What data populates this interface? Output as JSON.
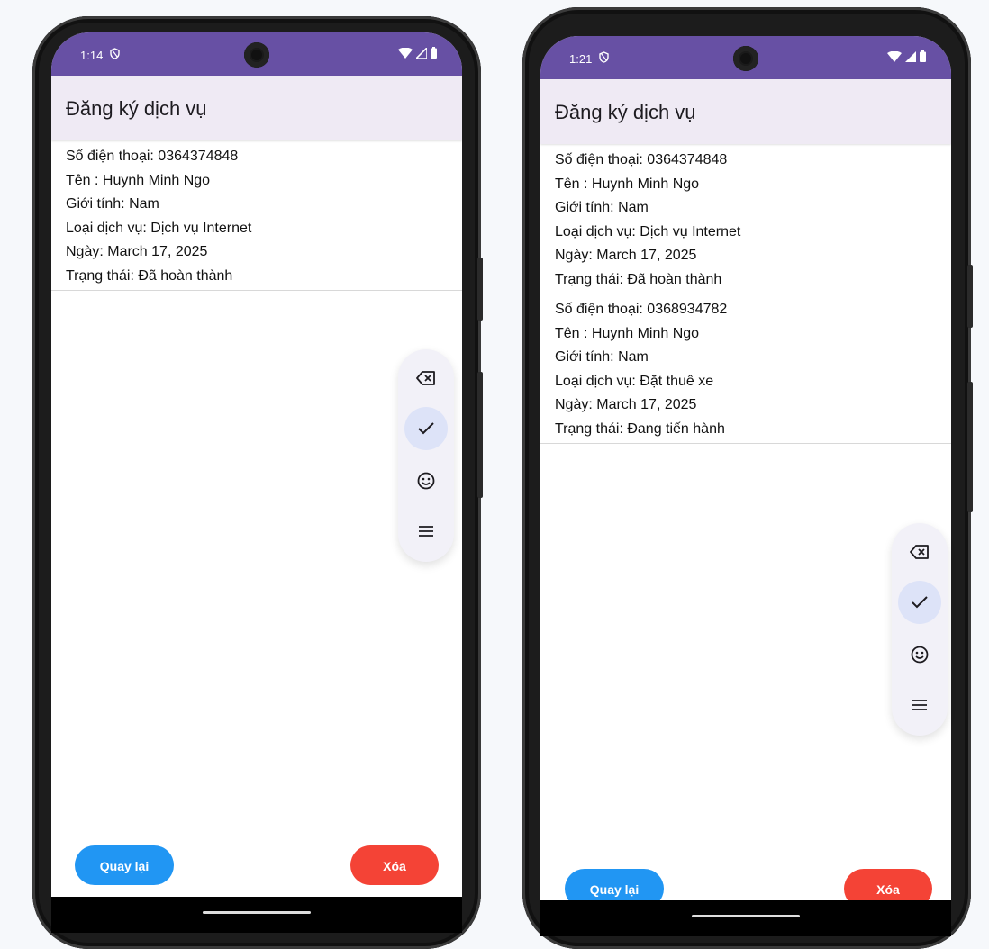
{
  "phones": [
    {
      "status_time": "1:14",
      "app_title": "Đăng ký dịch vụ",
      "records": [
        {
          "lines": [
            "Số điện thoại: 0364374848",
            "Tên : Huynh Minh Ngo",
            "Giới tính: Nam",
            "Loại dịch vụ: Dịch vụ Internet",
            "Ngày: March 17, 2025",
            "Trạng thái: Đã hoàn thành"
          ]
        }
      ],
      "back_label": "Quay lại",
      "delete_label": "Xóa"
    },
    {
      "status_time": "1:21",
      "app_title": "Đăng ký dịch vụ",
      "records": [
        {
          "lines": [
            "Số điện thoại: 0364374848",
            "Tên : Huynh Minh Ngo",
            "Giới tính: Nam",
            "Loại dịch vụ: Dịch vụ Internet",
            "Ngày: March 17, 2025",
            "Trạng thái: Đã hoàn thành"
          ]
        },
        {
          "lines": [
            "Số điện thoại: 0368934782",
            "Tên : Huynh Minh Ngo",
            "Giới tính: Nam",
            "Loại dịch vụ: Đặt thuê xe",
            "Ngày: March 17, 2025",
            "Trạng thái: Đang tiến hành"
          ]
        }
      ],
      "back_label": "Quay lại",
      "delete_label": "Xóa"
    }
  ],
  "floating_toolbar_icons": [
    "backspace-icon",
    "check-icon",
    "emoji-icon",
    "menu-icon"
  ],
  "colors": {
    "statusbar": "#6750a4",
    "appbar": "#efeaf4",
    "back_button": "#2196f3",
    "delete_button": "#f44336"
  }
}
